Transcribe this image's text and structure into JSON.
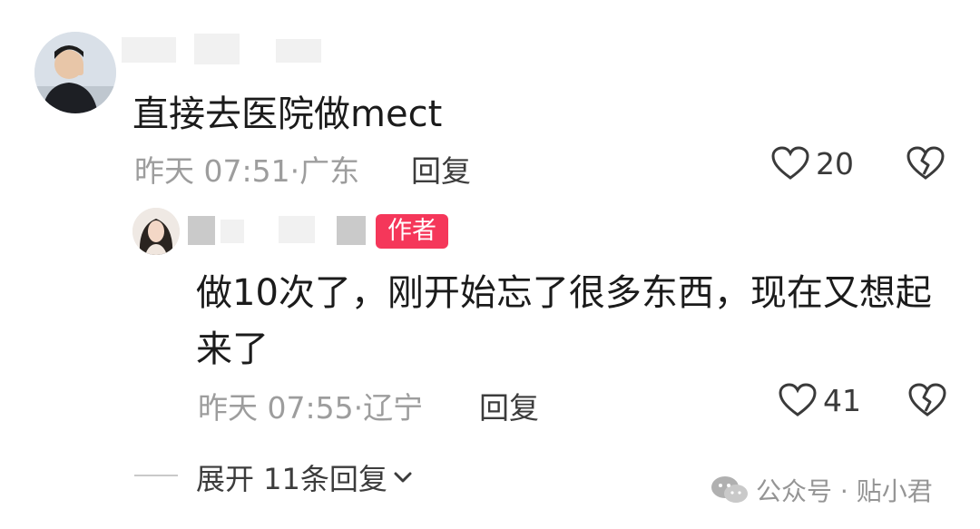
{
  "comment": {
    "text": "直接去医院做mect",
    "time": "昨天 07:51·",
    "location": "广东",
    "reply_label": "回复",
    "like_count": "20",
    "like_icon": "heart-outline-icon",
    "dislike_icon": "broken-heart-icon"
  },
  "reply": {
    "author_badge": "作者",
    "text": "做10次了，刚开始忘了很多东西，现在又想起来了",
    "time": "昨天 07:55·",
    "location": "辽宁",
    "reply_label": "回复",
    "like_count": "41"
  },
  "expand": {
    "label": "展开 11条回复"
  },
  "watermark": {
    "text": "公众号 · 贴小君"
  },
  "colors": {
    "author_badge_bg": "#f5375a",
    "meta_gray": "#9d9d9d"
  }
}
